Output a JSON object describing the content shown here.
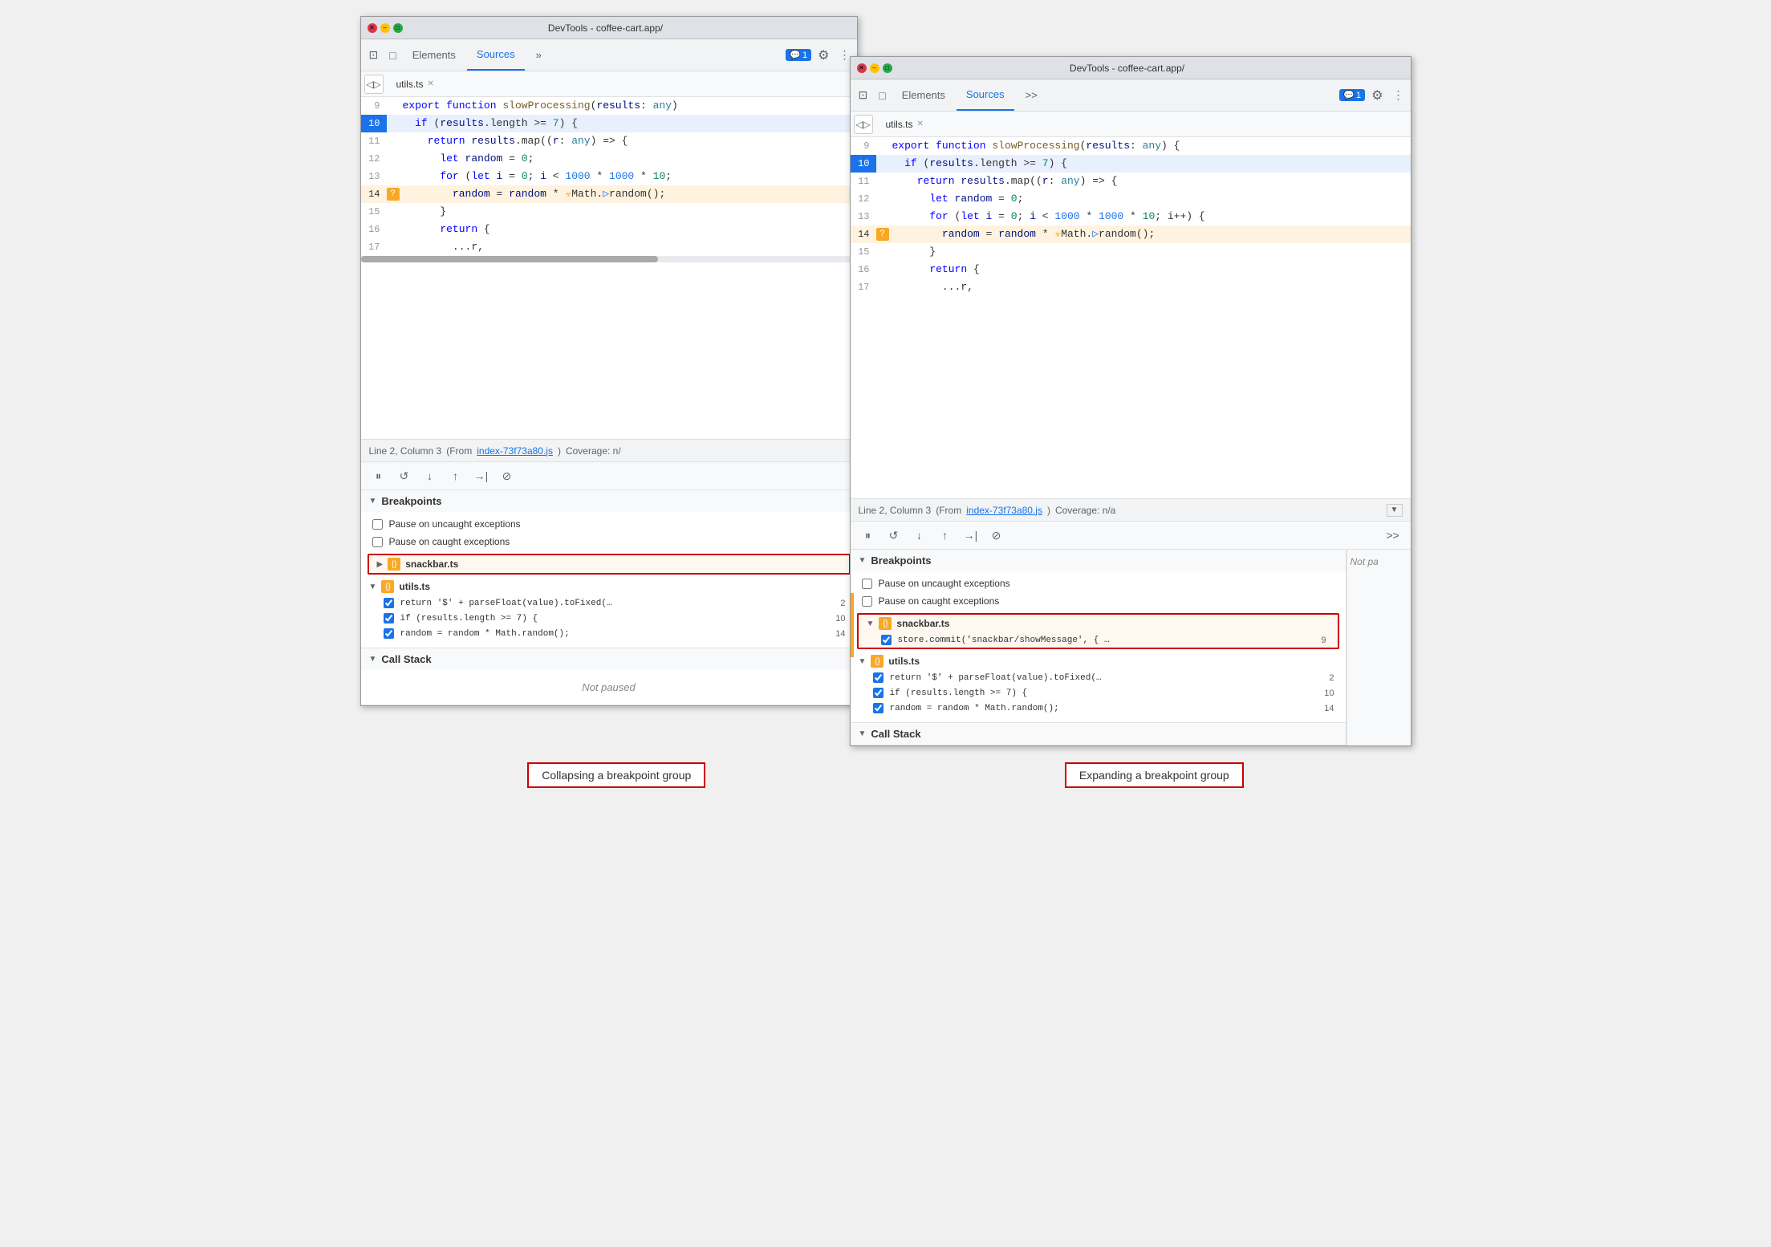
{
  "window1": {
    "title": "DevTools - coffee-cart.app/",
    "tabs": {
      "elements": "Elements",
      "sources": "Sources",
      "more": "»"
    },
    "badge": "1",
    "file_tab": "utils.ts",
    "code_lines": [
      {
        "num": "9",
        "content": "export function slowProcessing(results: any)",
        "type": "normal"
      },
      {
        "num": "10",
        "content": "  if (results.length >= 7) {",
        "type": "active"
      },
      {
        "num": "11",
        "content": "    return results.map((r: any) => {",
        "type": "normal"
      },
      {
        "num": "12",
        "content": "      let random = 0;",
        "type": "normal"
      },
      {
        "num": "13",
        "content": "      for (let i = 0; i < 1000 * 1000 * 10;",
        "type": "normal"
      },
      {
        "num": "14",
        "content": "        random = random * ☣Math.▷random();",
        "type": "breakpoint"
      },
      {
        "num": "15",
        "content": "      }",
        "type": "normal"
      },
      {
        "num": "16",
        "content": "      return {",
        "type": "normal"
      },
      {
        "num": "17",
        "content": "        ...r,",
        "type": "normal"
      }
    ],
    "status_bar": {
      "line_col": "Line 2, Column 3",
      "from_text": "(From",
      "from_link": "index-73f73a80.js",
      "coverage": "Coverage: n/"
    },
    "breakpoints": {
      "header": "Breakpoints",
      "pause_uncaught": "Pause on uncaught exceptions",
      "pause_caught": "Pause on caught exceptions",
      "groups": [
        {
          "name": "snackbar.ts",
          "expanded": false,
          "highlighted": true,
          "items": []
        },
        {
          "name": "utils.ts",
          "expanded": true,
          "highlighted": false,
          "items": [
            {
              "code": "return '$' + parseFloat(value).toFixed(…",
              "line": "2",
              "checked": true
            },
            {
              "code": "if (results.length >= 7) {",
              "line": "10",
              "checked": true
            },
            {
              "code": "random = random * Math.random();",
              "line": "14",
              "checked": true
            }
          ]
        }
      ]
    },
    "call_stack": {
      "header": "Call Stack",
      "status": "Not paused"
    }
  },
  "window2": {
    "title": "DevTools - coffee-cart.app/",
    "tabs": {
      "elements": "Elements",
      "sources": "Sources",
      "more": ">>"
    },
    "badge": "1",
    "file_tab": "utils.ts",
    "code_lines": [
      {
        "num": "9",
        "content": "export function slowProcessing(results: any) {",
        "type": "normal"
      },
      {
        "num": "10",
        "content": "  if (results.length >= 7) {",
        "type": "active"
      },
      {
        "num": "11",
        "content": "    return results.map((r: any) => {",
        "type": "normal"
      },
      {
        "num": "12",
        "content": "      let random = 0;",
        "type": "normal"
      },
      {
        "num": "13",
        "content": "      for (let i = 0; i < 1000 * 1000 * 10; i++) {",
        "type": "normal"
      },
      {
        "num": "14",
        "content": "        random = random * ☣Math.▷random();",
        "type": "breakpoint"
      },
      {
        "num": "15",
        "content": "      }",
        "type": "normal"
      },
      {
        "num": "16",
        "content": "      return {",
        "type": "normal"
      },
      {
        "num": "17",
        "content": "        ...r,",
        "type": "normal"
      }
    ],
    "status_bar": {
      "line_col": "Line 2, Column 3",
      "from_text": "(From",
      "from_link": "index-73f73a80.js",
      "coverage": "Coverage: n/a"
    },
    "breakpoints": {
      "header": "Breakpoints",
      "pause_uncaught": "Pause on uncaught exceptions",
      "pause_caught": "Pause on caught exceptions",
      "groups": [
        {
          "name": "snackbar.ts",
          "expanded": true,
          "highlighted": true,
          "items": [
            {
              "code": "store.commit('snackbar/showMessage', { …",
              "line": "9",
              "checked": true
            }
          ]
        },
        {
          "name": "utils.ts",
          "expanded": true,
          "highlighted": false,
          "items": [
            {
              "code": "return '$' + parseFloat(value).toFixed(…",
              "line": "2",
              "checked": true
            },
            {
              "code": "if (results.length >= 7) {",
              "line": "10",
              "checked": true
            },
            {
              "code": "random = random * Math.random();",
              "line": "14",
              "checked": true
            }
          ]
        }
      ]
    },
    "call_stack": {
      "header": "Call Stack"
    },
    "not_paused_label": "Not pa"
  },
  "labels": {
    "collapsing": "Collapsing a breakpoint group",
    "expanding": "Expanding a breakpoint group"
  }
}
